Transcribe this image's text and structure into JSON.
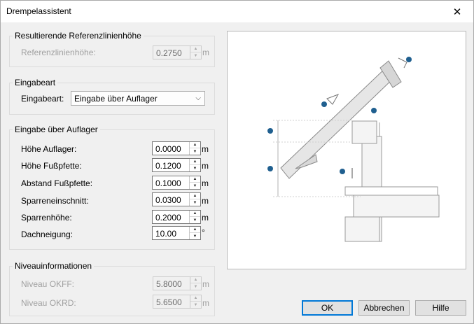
{
  "window": {
    "title": "Drempelassistent",
    "close_glyph": "✕"
  },
  "group_result": {
    "legend": "Resultierende Referenzlinienhöhe",
    "label": "Referenzlinienhöhe:",
    "value": "0.2750",
    "unit": "m"
  },
  "group_mode": {
    "legend": "Eingabeart",
    "label": "Eingabeart:",
    "selected": "Eingabe über Auflager"
  },
  "group_input": {
    "legend": "Eingabe über Auflager",
    "fields": [
      {
        "label": "Höhe Auflager:",
        "value": "0.0000",
        "unit": "m"
      },
      {
        "label": "Höhe Fußpfette:",
        "value": "0.1200",
        "unit": "m"
      },
      {
        "label": "Abstand Fußpfette:",
        "value": "0.1000",
        "unit": "m"
      },
      {
        "label": "Sparreneinschnitt:",
        "value": "0.0300",
        "unit": "m"
      },
      {
        "label": "Sparrenhöhe:",
        "value": "0.2000",
        "unit": "m"
      },
      {
        "label": "Dachneigung:",
        "value": "10.00",
        "unit": "°"
      }
    ]
  },
  "group_level": {
    "legend": "Niveauinformationen",
    "fields": [
      {
        "label": "Niveau OKFF:",
        "value": "5.8000",
        "unit": "m"
      },
      {
        "label": "Niveau OKRD:",
        "value": "5.6500",
        "unit": "m"
      }
    ]
  },
  "buttons": {
    "ok": "OK",
    "cancel": "Abbrechen",
    "help": "Hilfe"
  },
  "colors": {
    "accent": "#0078d7",
    "marker": "#1f5f8f"
  }
}
